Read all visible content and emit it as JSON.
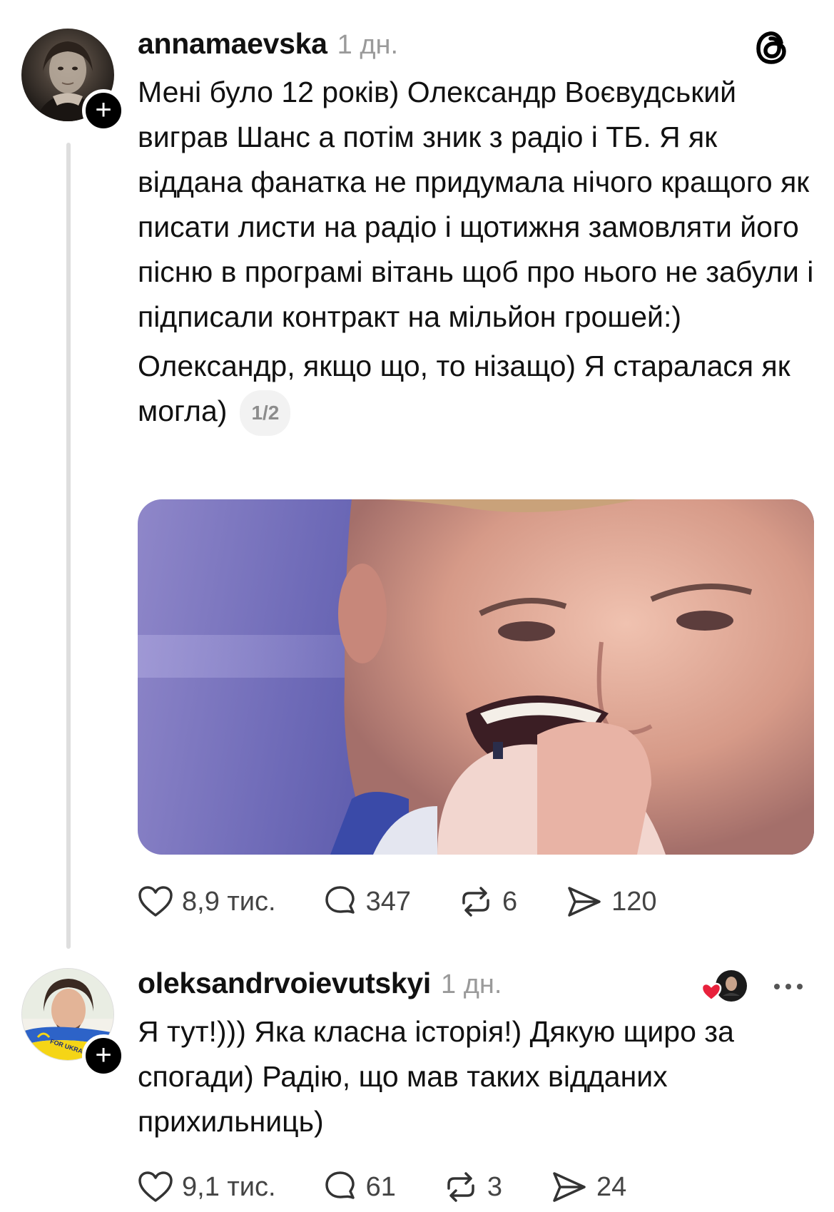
{
  "post1": {
    "username": "annamaevska",
    "time": "1 дн.",
    "text_paragraph_1": "Мені було 12 років) Олександр Воєвудський виграв Шанс а потім зник з радіо і ТБ. Я як віддана фанатка не придумала нічого кращого як писати листи на радіо і щотижня замовляти його пісню в програмі вітань щоб про нього не забули і підписали контракт на мільйон грошей:)",
    "text_paragraph_2": "Олександр, якщо що, то нізащо) Я старалася як могла)",
    "page_indicator": "1/2",
    "likes": "8,9 тис.",
    "replies": "347",
    "reposts": "6",
    "shares": "120"
  },
  "post2": {
    "username": "oleksandrvoievutskyi",
    "time": "1 дн.",
    "avatar_badge_text": "FOR UKRAINE",
    "text": "Я тут!))) Яка класна історія!) Дякую щиро за спогади) Радію, що мав таких відданих прихильниць)",
    "likes": "9,1 тис.",
    "replies": "61",
    "reposts": "3",
    "shares": "24"
  },
  "icons": {
    "follow": "plus-icon",
    "app": "threads-logo-icon",
    "like": "heart-icon",
    "reply": "comment-bubble-icon",
    "repost": "repost-icon",
    "share": "send-icon",
    "more": "more-dots-icon",
    "liked_by_author": "heart-badge-icon"
  },
  "colors": {
    "text": "#111111",
    "muted": "#9a9a9a",
    "action": "#444444",
    "heart_badge": "#e8213c",
    "thread_line": "#dedede"
  }
}
